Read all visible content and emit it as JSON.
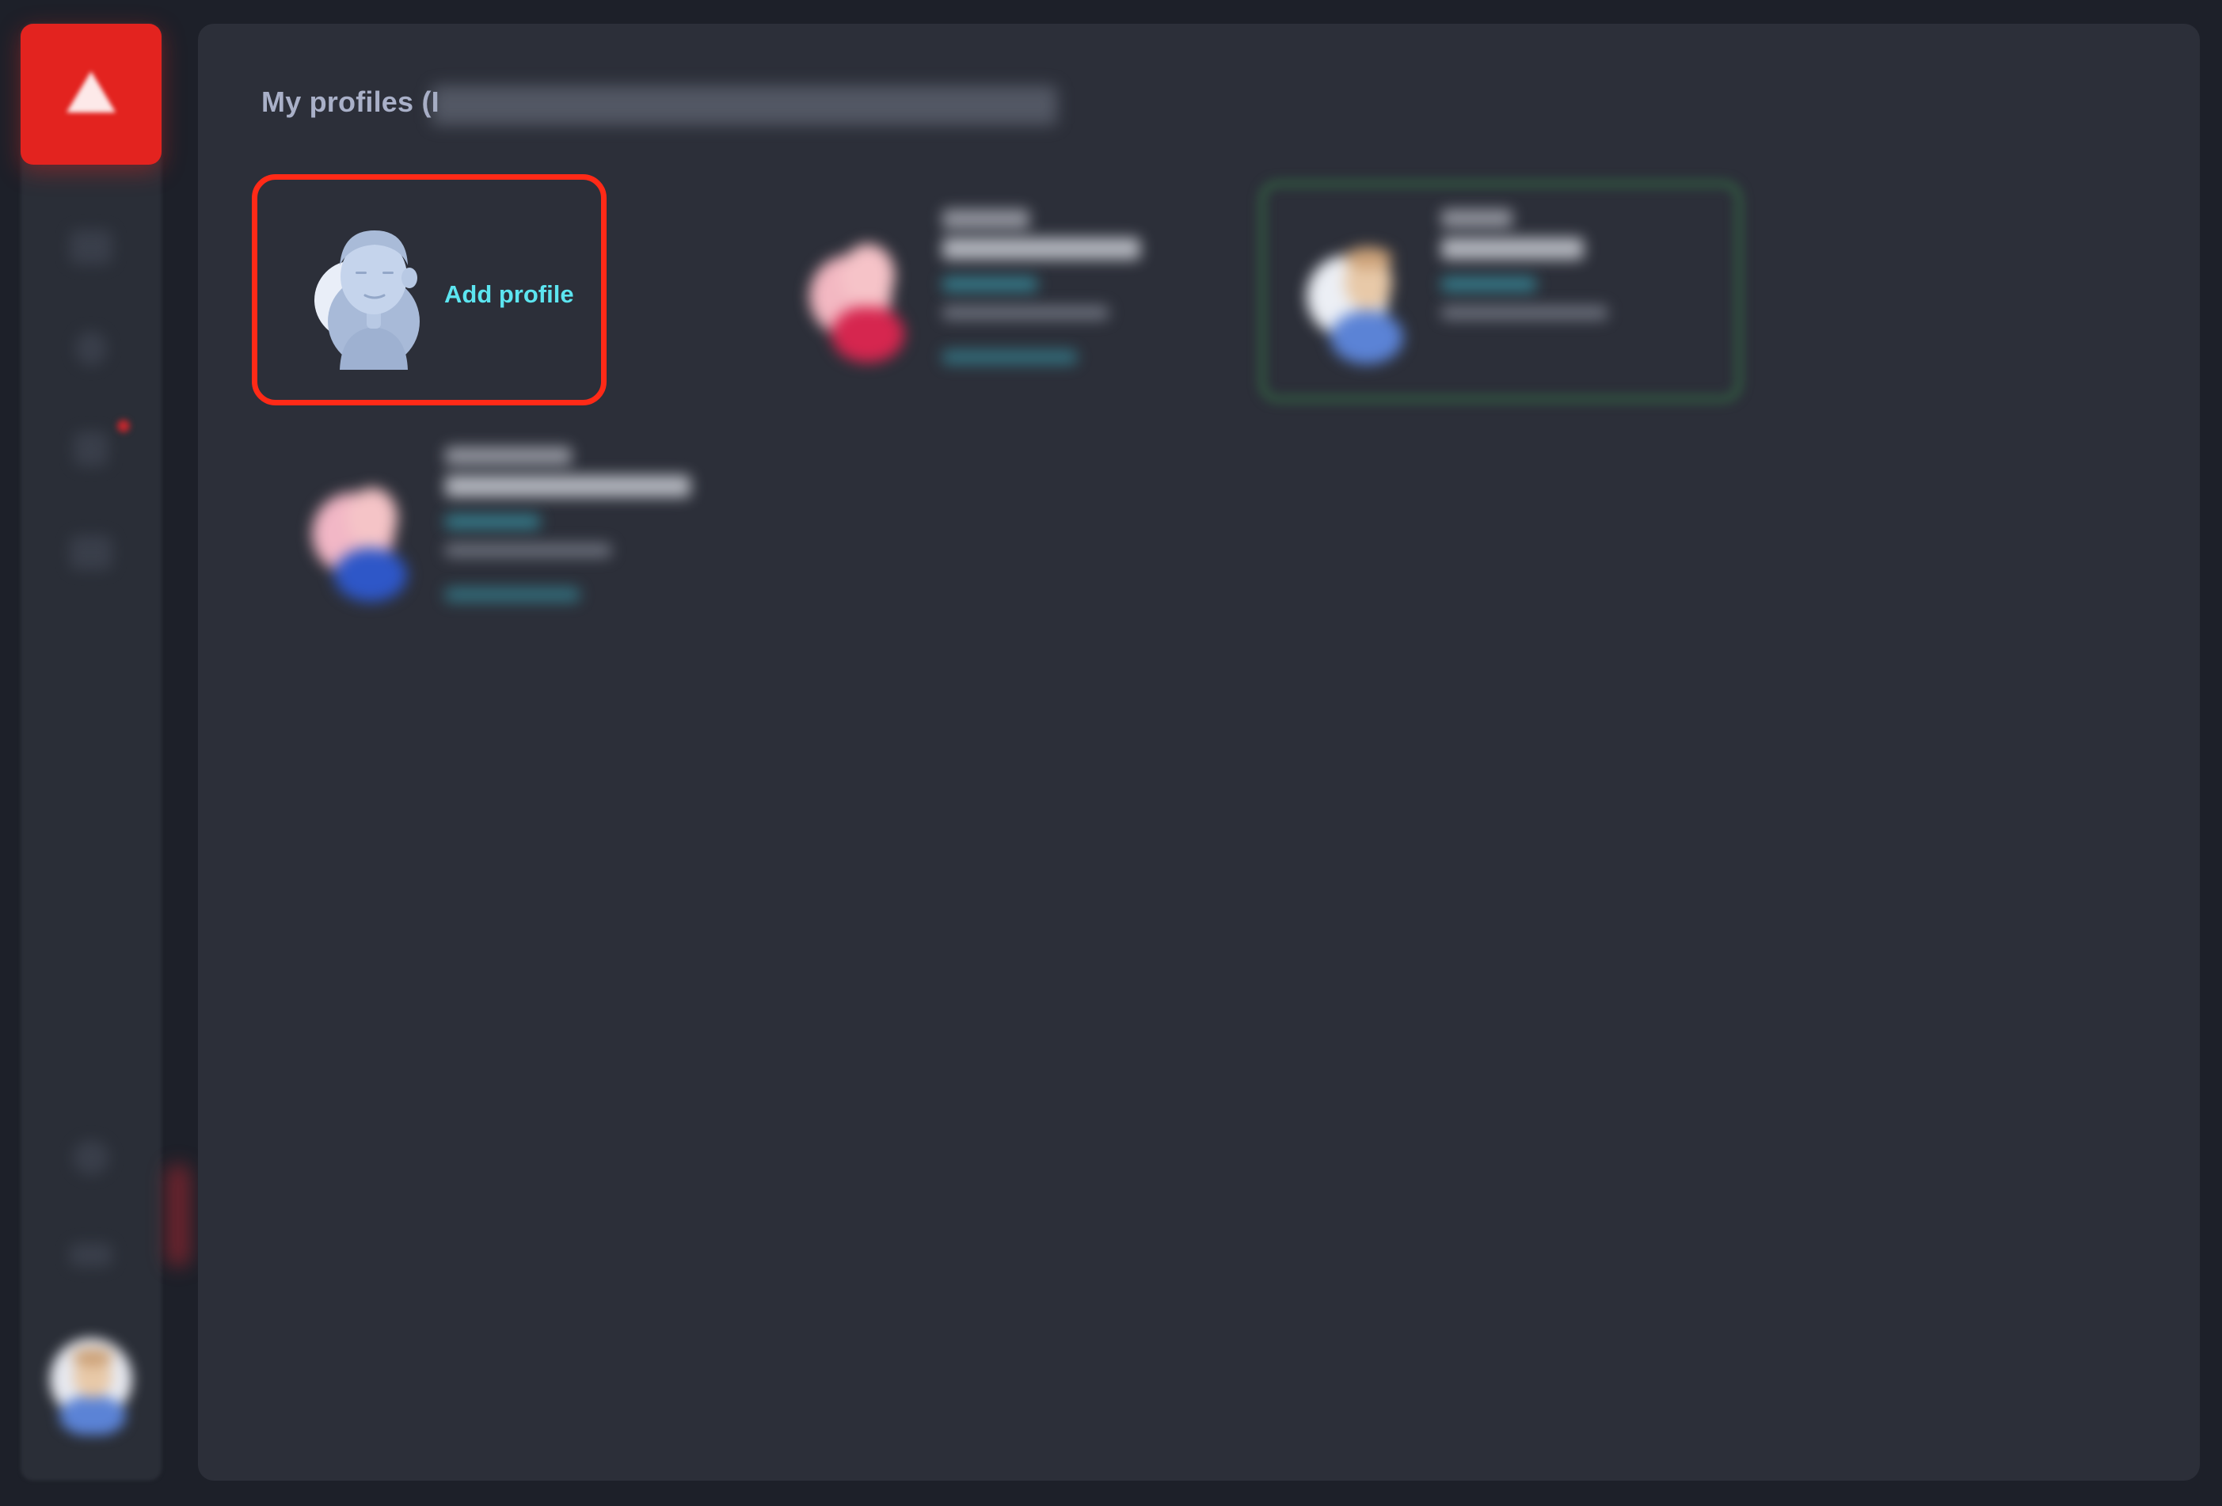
{
  "header": {
    "title": "My profiles (I"
  },
  "add_profile": {
    "label": "Add profile"
  },
  "profiles": [
    {
      "name": "",
      "status": ""
    },
    {
      "name": "",
      "status": ""
    },
    {
      "name": "",
      "status": ""
    }
  ],
  "sidebar": {
    "items": [
      {
        "icon": "home-icon"
      },
      {
        "icon": "user-icon"
      },
      {
        "icon": "notifications-icon"
      },
      {
        "icon": "mail-icon"
      },
      {
        "icon": "settings-icon"
      },
      {
        "icon": "help-icon"
      }
    ]
  },
  "colors": {
    "accent_red": "#e3231f",
    "highlight_red": "#ff2a17",
    "link_cyan": "#5ce5f0",
    "panel_bg": "#2c2f39",
    "active_green": "#346e46"
  }
}
